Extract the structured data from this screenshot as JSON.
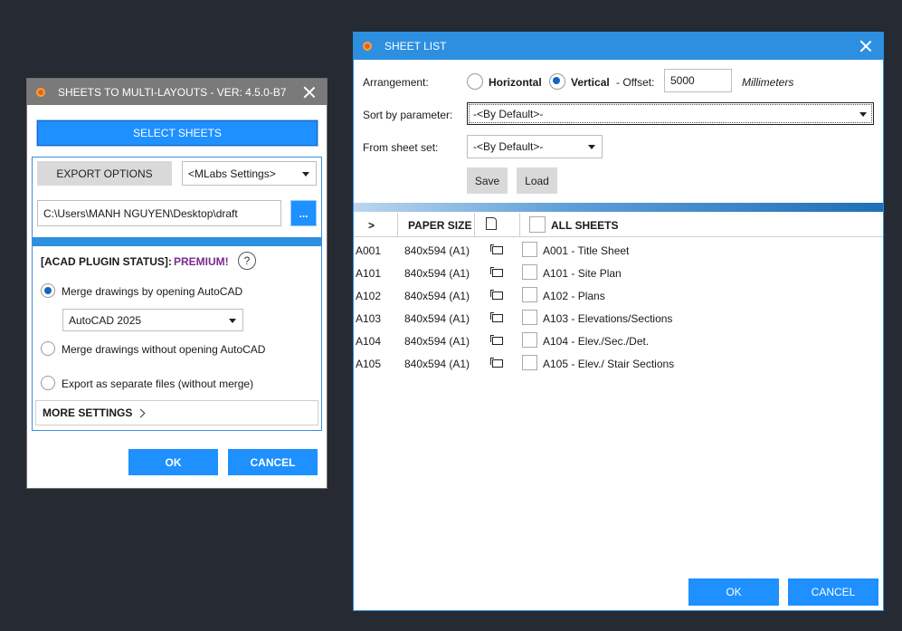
{
  "left_dialog": {
    "title": "SHEETS TO MULTI-LAYOUTS - VER: 4.5.0-B7",
    "select_sheets_label": "SELECT SHEETS",
    "export_options_label": "EXPORT OPTIONS",
    "settings_selected": "<MLabs Settings>",
    "path_value": "C:\\Users\\MANH NGUYEN\\Desktop\\draft",
    "browse_label": "...",
    "plugin_status_label": "[ACAD PLUGIN STATUS]:",
    "plugin_status_value": "PREMIUM!",
    "help_label": "?",
    "option_merge_open": "Merge drawings by opening AutoCAD",
    "autocad_version": "AutoCAD 2025",
    "option_merge_no_open": "Merge drawings without opening AutoCAD",
    "option_separate": "Export as separate files (without merge)",
    "more_settings_label": "MORE SETTINGS",
    "ok_label": "OK",
    "cancel_label": "CANCEL"
  },
  "right_dialog": {
    "title": "SHEET LIST",
    "arrangement_label": "Arrangement:",
    "horizontal_label": "Horizontal",
    "vertical_label": "Vertical",
    "offset_label": "- Offset:",
    "offset_value": "5000",
    "offset_unit": "Millimeters",
    "sort_label": "Sort by parameter:",
    "sort_selected": "-<By Default>-",
    "sheet_set_label": "From sheet set:",
    "sheet_set_selected": "-<By Default>-",
    "save_label": "Save",
    "load_label": "Load",
    "table": {
      "col_expand": ">",
      "col_paper_size": "PAPER SIZE",
      "col_all_sheets": "ALL SHEETS",
      "rows": [
        {
          "number": "A001",
          "paper_size": "840x594 (A1)",
          "name": "A001 - Title Sheet"
        },
        {
          "number": "A101",
          "paper_size": "840x594 (A1)",
          "name": "A101 - Site Plan"
        },
        {
          "number": "A102",
          "paper_size": "840x594 (A1)",
          "name": "A102 - Plans"
        },
        {
          "number": "A103",
          "paper_size": "840x594 (A1)",
          "name": "A103 - Elevations/Sections"
        },
        {
          "number": "A104",
          "paper_size": "840x594 (A1)",
          "name": "A104 - Elev./Sec./Det."
        },
        {
          "number": "A105",
          "paper_size": "840x594 (A1)",
          "name": "A105 - Elev./ Stair Sections"
        }
      ]
    },
    "ok_label": "OK",
    "cancel_label": "CANCEL"
  },
  "colors": {
    "background": "#252a33",
    "left_titlebar": "#7a7a7a",
    "right_titlebar": "#2d8fe0",
    "accent_blue": "#1e90ff",
    "premium_purple": "#7b2a8b"
  }
}
